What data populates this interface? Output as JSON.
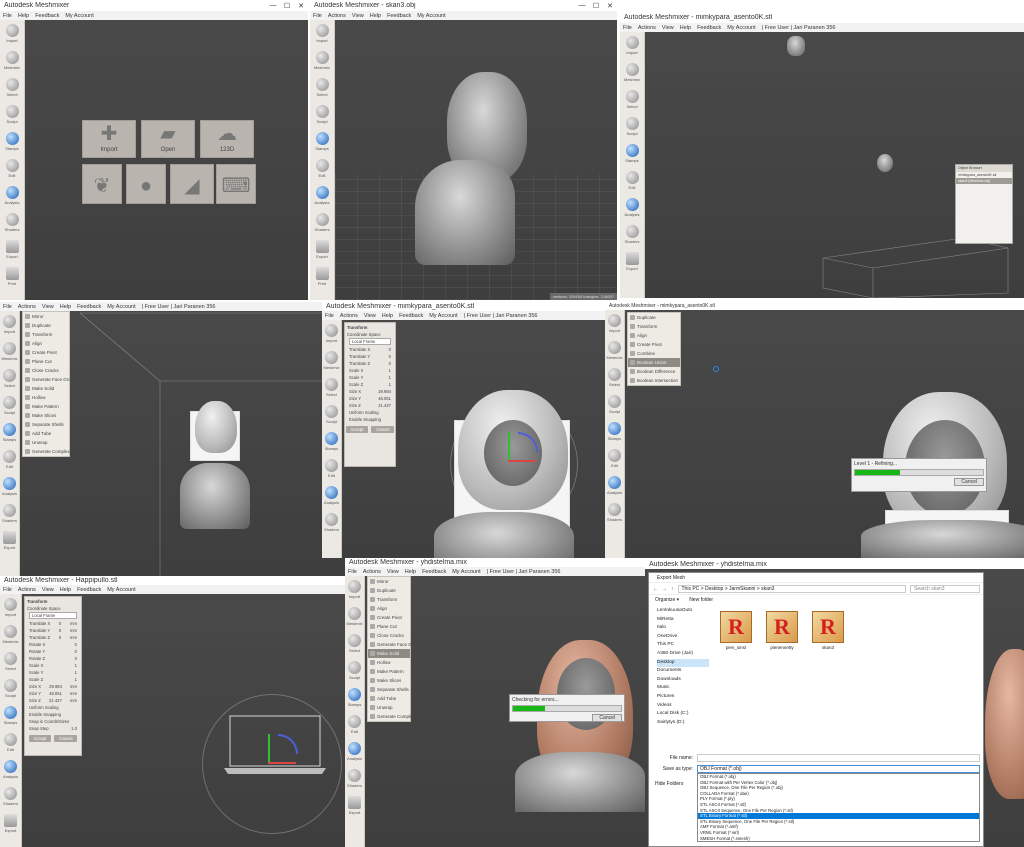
{
  "panels": {
    "p1": {
      "title": "Autodesk Meshmixer",
      "menu": [
        "File",
        "Help",
        "Feedback",
        "My Account"
      ]
    },
    "p2": {
      "title": "Autodesk Meshmixer - skan3.obj",
      "menu": [
        "File",
        "Actions",
        "View",
        "Help",
        "Feedback",
        "My Account"
      ],
      "status": "vertices: 109454 triangles: 218657"
    },
    "p3": {
      "title": "Autodesk Meshmixer - mimkypara_asento0K.stl",
      "menu": [
        "File",
        "Actions",
        "View",
        "Help",
        "Feedback",
        "My Account",
        "| Free User | Jari Paranen 356"
      ],
      "object_browser": {
        "title": "Object Browser",
        "items": [
          "mimkypara_asento0K.stl",
          "skan3 (Meshmix.obj)"
        ]
      }
    },
    "p4": {
      "title": "",
      "menu": [
        "File",
        "Actions",
        "View",
        "Help",
        "Feedback",
        "My Account",
        "| Free User | Jari Paranen 356"
      ]
    },
    "p5": {
      "title": "Autodesk Meshmixer - mimkypara_asento0K.stl",
      "menu": [
        "File",
        "Actions",
        "View",
        "Help",
        "Feedback",
        "My Account",
        "| Free User | Jari Paranen 356"
      ]
    },
    "p6": {
      "title": "Autodesk Meshmixer - mimkypara_asento0K.stl",
      "menu": [],
      "progress": {
        "label": "Level 1 - Refining...",
        "cancel": "Cancel",
        "fraction": 0.35
      }
    },
    "p7": {
      "title": "Autodesk Meshmixer - Happipullo.stl",
      "menu": [
        "File",
        "Actions",
        "View",
        "Help",
        "Feedback",
        "My Account"
      ]
    },
    "p8": {
      "title": "Autodesk Meshmixer - yhdistelma.mix",
      "menu": [
        "File",
        "Actions",
        "View",
        "Help",
        "Feedback",
        "My Account",
        "| Free User | Jari Paranen 356"
      ],
      "progress": {
        "label": "Checking for errors...",
        "cancel": "Cancel",
        "fraction": 0.3
      }
    },
    "p9": {
      "title": "Autodesk Meshmixer - yhdistelma.mix"
    }
  },
  "toolbar": [
    "Import",
    "Meshmix",
    "Select",
    "Sculpt",
    "Stamps",
    "Edit",
    "Analysis",
    "Shaders",
    "Export",
    "Print"
  ],
  "start_buttons": [
    "Import",
    "Open",
    "123D",
    "",
    "",
    "",
    ""
  ],
  "edit_menu": [
    "Mirror",
    "Duplicate",
    "Transform",
    "Align",
    "Create Pivot",
    "Plane Cut",
    "Close Cracks",
    "Generate Face Groups",
    "Make Solid",
    "Hollow",
    "Make Pattern",
    "Make Slices",
    "Separate Shells",
    "Add Tube",
    "Unwrap",
    "Generate Complex"
  ],
  "edit_menu2": [
    "Duplicate",
    "Transform",
    "Align",
    "Create Pivot",
    "Combine",
    "Boolean Union",
    "Boolean Difference",
    "Boolean Intersection"
  ],
  "transform": {
    "title": "Transform",
    "coord_label": "Coordinate Space",
    "coord_value": "Local Frame",
    "rows": [
      [
        "Translate X",
        "0",
        "mm"
      ],
      [
        "Translate Y",
        "0",
        "mm"
      ],
      [
        "Translate Z",
        "0",
        "mm"
      ],
      [
        "Rotate X",
        "0",
        ""
      ],
      [
        "Rotate Y",
        "0",
        ""
      ],
      [
        "Rotate Z",
        "0",
        ""
      ],
      [
        "Scale X",
        "1",
        ""
      ],
      [
        "Scale Y",
        "1",
        ""
      ],
      [
        "Scale Z",
        "1",
        ""
      ],
      [
        "Size X",
        "29.984",
        "mm"
      ],
      [
        "Size Y",
        "46.051",
        "mm"
      ],
      [
        "Size Z",
        "21.427",
        "mm"
      ]
    ],
    "checks": [
      "Uniform Scaling",
      "Enable Snapping",
      "Snap in Coords/Sizes"
    ],
    "snap_step": "Snap Step",
    "snap_value": "1.0",
    "accept": "Accept",
    "cancel": "Cancel"
  },
  "export_dialog": {
    "title": "Export Mesh",
    "path": "This PC  >  Desktop  >  JarmSkanni  >  skan3",
    "search": "Search skan3",
    "organize": "Organize ▾",
    "new_folder": "New folder",
    "nav": [
      "LentokuusaOuto",
      "MiRetta",
      "Italo",
      "OneDrive",
      "This PC",
      "A360 Drive (Jari)",
      "Desktop",
      "Documents",
      "Downloads",
      "Music",
      "Pictures",
      "Videos",
      "Local Disk (C:)",
      "Sairlytys (D:)"
    ],
    "files": [
      "pien_sinst",
      "pienennetty",
      "skan3"
    ],
    "file_name_label": "File name:",
    "save_type_label": "Save as type:",
    "save_type_value": "OBJ Format (*.obj)",
    "hide_folders": "Hide Folders",
    "types": [
      "OBJ Format (*.obj)",
      "OBJ Format with Per Vertex Color (*.obj)",
      "OBJ Sequence, One File Per Region (*.obj)",
      "COLLADA Format (*.dae)",
      "PLY Format (*.ply)",
      "STL ASCII Format (*.stl)",
      "STL ASCII Sequence, One File Per Region (*.stl)",
      "STL Binary Format (*.stl)",
      "STL Binary Sequence, One File Per Region (*.stl)",
      "AMF Format (*.amf)",
      "VRML Format (*.wrl)",
      "SMESH Format (*.smesh)"
    ],
    "selected_type_index": 7
  },
  "window_buttons": [
    "—",
    "☐",
    "✕"
  ]
}
